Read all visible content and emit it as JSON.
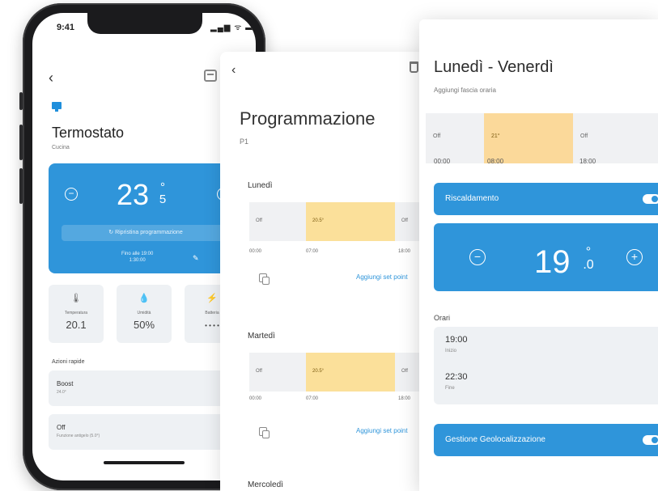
{
  "phone": {
    "status_time": "9:41",
    "status_icons": "▂▄▆ ᯤ ▬",
    "back_icon": "‹",
    "title": "Termostato",
    "subtitle": "Cucina",
    "temp_integer": "23",
    "temp_degree": "°",
    "temp_decimal": "5",
    "minus": "−",
    "plus": "+",
    "resume_label": "↻ Ripristina programmazione",
    "until_label": "Fino alle 19:00",
    "until_time": "1:30:00",
    "pencil": "✎",
    "stats": [
      {
        "icon": "🌡",
        "label": "Temperatura",
        "value": "20.1"
      },
      {
        "icon": "💧",
        "label": "Umidità",
        "value": "50%"
      },
      {
        "icon": "⚡",
        "label": "Batteria",
        "value": "• • • •"
      }
    ],
    "quick_title": "Azioni rapide",
    "quick": [
      {
        "name": "Boost",
        "sub": "24.0°",
        "icon": "⤢"
      },
      {
        "name": "Off",
        "sub": "Funzione antigelo (5.0°)",
        "icon": "⤢"
      }
    ]
  },
  "programmazione": {
    "back_icon": "‹",
    "title": "Programmazione",
    "subtitle": "P1",
    "days": [
      {
        "name": "Lunedì",
        "segments": [
          {
            "label": "Off",
            "type": "off"
          },
          {
            "label": "20.5°",
            "type": "on"
          },
          {
            "label": "Off",
            "type": "off"
          }
        ],
        "times": [
          "00:00",
          "07:00",
          "18:00"
        ],
        "add_link": "Aggiungi set point"
      },
      {
        "name": "Martedì",
        "segments": [
          {
            "label": "Off",
            "type": "off"
          },
          {
            "label": "20.5°",
            "type": "on"
          },
          {
            "label": "Off",
            "type": "off"
          }
        ],
        "times": [
          "00:00",
          "07:00",
          "18:00"
        ],
        "add_link": "Aggiungi set point"
      },
      {
        "name": "Mercoledì"
      }
    ]
  },
  "fascia": {
    "title": "Lunedì - Venerdì",
    "subtitle": "Aggiungi fascia oraria",
    "segments": [
      {
        "label": "Off",
        "type": "off"
      },
      {
        "label": "21°",
        "type": "on"
      },
      {
        "label": "Off",
        "type": "off"
      }
    ],
    "times": [
      "00:00",
      "08:00",
      "18:00"
    ],
    "heating_label": "Riscaldamento",
    "heating_on": true,
    "temp_integer": "19",
    "temp_degree": "°",
    "temp_decimal": ".0",
    "minus": "−",
    "plus": "+",
    "hours_title": "Orari",
    "start_time": "19:00",
    "start_label": "Inizio",
    "end_time": "22:30",
    "end_label": "Fine",
    "geo_label": "Gestione Geolocalizzazione",
    "geo_on": true
  },
  "colors": {
    "accent": "#2f95da",
    "heat_segment": "#fbe09a",
    "off_segment": "#f0f1f3",
    "phone_frame": "#1b1b1d"
  }
}
